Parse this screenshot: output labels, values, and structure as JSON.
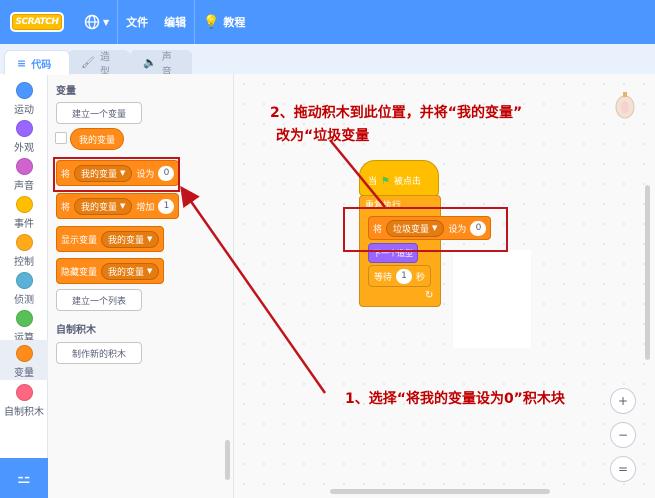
{
  "menubar": {
    "logo_text": "SCRATCH",
    "file_label": "文件",
    "edit_label": "编辑",
    "tutorial_label": "教程",
    "globe_icon": "globe-icon",
    "bulb_icon": "lightbulb-icon",
    "bg_color": "#4c97ff"
  },
  "tabs": [
    {
      "label": "代码",
      "icon": "code-icon",
      "active": true
    },
    {
      "label": "造型",
      "icon": "brush-icon",
      "active": false
    },
    {
      "label": "声音",
      "icon": "speaker-icon",
      "active": false
    }
  ],
  "categories": [
    {
      "label": "运动",
      "color": "#4c97ff"
    },
    {
      "label": "外观",
      "color": "#9966ff"
    },
    {
      "label": "声音",
      "color": "#cf63cf"
    },
    {
      "label": "事件",
      "color": "#ffbf00"
    },
    {
      "label": "控制",
      "color": "#ffab19"
    },
    {
      "label": "侦测",
      "color": "#5cb1d6"
    },
    {
      "label": "运算",
      "color": "#59c059"
    },
    {
      "label": "变量",
      "color": "#ff8c1a",
      "selected": true
    },
    {
      "label": "自制积木",
      "color": "#ff6680"
    }
  ],
  "palette": {
    "variables_heading": "变量",
    "make_variable_label": "建立一个变量",
    "my_variable_label": "我的变量",
    "set_block": {
      "prefix": "将",
      "var": "我的变量",
      "op": "设为",
      "value": "0"
    },
    "change_block": {
      "prefix": "将",
      "var": "我的变量",
      "op": "增加",
      "value": "1"
    },
    "show_block": {
      "prefix": "显示变量",
      "var": "我的变量"
    },
    "hide_block": {
      "prefix": "隐藏变量",
      "var": "我的变量"
    },
    "make_list_label": "建立一个列表",
    "my_blocks_heading": "自制积木",
    "make_block_label": "制作新的积木"
  },
  "script": {
    "hat_label": "当",
    "hat_suffix": "被点击",
    "forever_label": "重复执行",
    "set_prefix": "将",
    "set_var": "垃圾变量",
    "set_op": "设为",
    "set_value": "0",
    "purple_label": "下一个造型",
    "wait_prefix": "等待",
    "wait_value": "1",
    "wait_suffix": "秒"
  },
  "zoom": {
    "in": "+",
    "out": "−",
    "reset": "="
  },
  "annotations": {
    "step2_line1": "2、拖动积木到此位置，并将“我的变量”",
    "step2_line2": "改为“垃圾变量",
    "step1": "1、选择“将我的变量设为0”积木块",
    "color": "#c0141c"
  }
}
